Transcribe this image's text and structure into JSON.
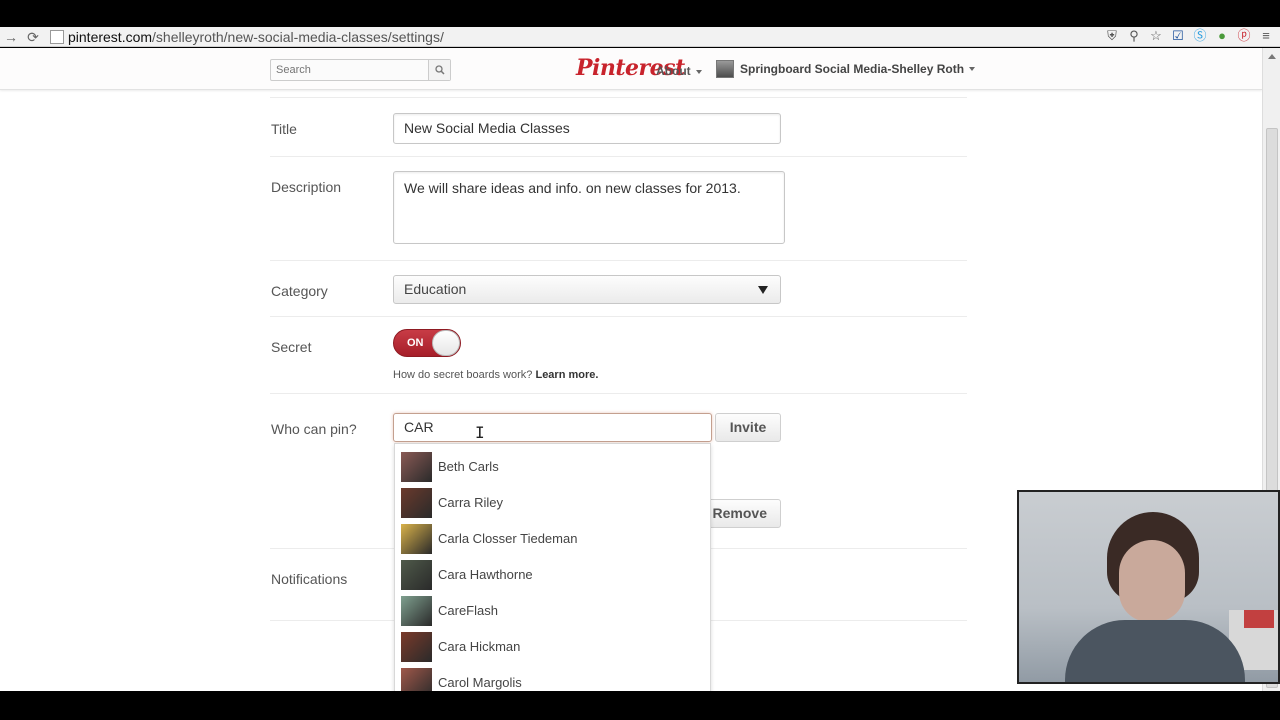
{
  "browser": {
    "url_host": "pinterest.com",
    "url_path": "/shelleyroth/new-social-media-classes/settings/",
    "extension_icons": [
      "shield-icon",
      "search-icon",
      "star-icon",
      "check-icon",
      "skype-icon",
      "green-dot-icon",
      "pinterest-icon",
      "menu-icon"
    ]
  },
  "header": {
    "search_placeholder": "Search",
    "logo": "Pinterest",
    "about_label": "About",
    "user_name": "Springboard Social Media-Shelley Roth"
  },
  "form": {
    "title_label": "Title",
    "title_value": "New Social Media Classes",
    "description_label": "Description",
    "description_value": "We will share ideas and info. on new classes for 2013.",
    "category_label": "Category",
    "category_value": "Education",
    "secret_label": "Secret",
    "secret_toggle": "ON",
    "secret_help": "How do secret boards work?",
    "secret_help_link": "Learn more.",
    "who_can_pin_label": "Who can pin?",
    "who_can_pin_value": "CAR",
    "invite_button": "Invite",
    "remove_button": "Remove",
    "notifications_label": "Notifications"
  },
  "suggestions": [
    {
      "name": "Beth Carls",
      "color": "#8a5a55"
    },
    {
      "name": "Carra Riley",
      "color": "#6b3a2c"
    },
    {
      "name": "Carla Closser Tiedeman",
      "color": "#d9b24a"
    },
    {
      "name": "Cara Hawthorne",
      "color": "#4f5a4a"
    },
    {
      "name": "CareFlash",
      "color": "#7fa08f"
    },
    {
      "name": "Cara Hickman",
      "color": "#7a3a2a"
    },
    {
      "name": "Carol Margolis",
      "color": "#a0584a"
    }
  ],
  "colors": {
    "brand": "#c8232c",
    "toggle_on": "#b3262f"
  }
}
